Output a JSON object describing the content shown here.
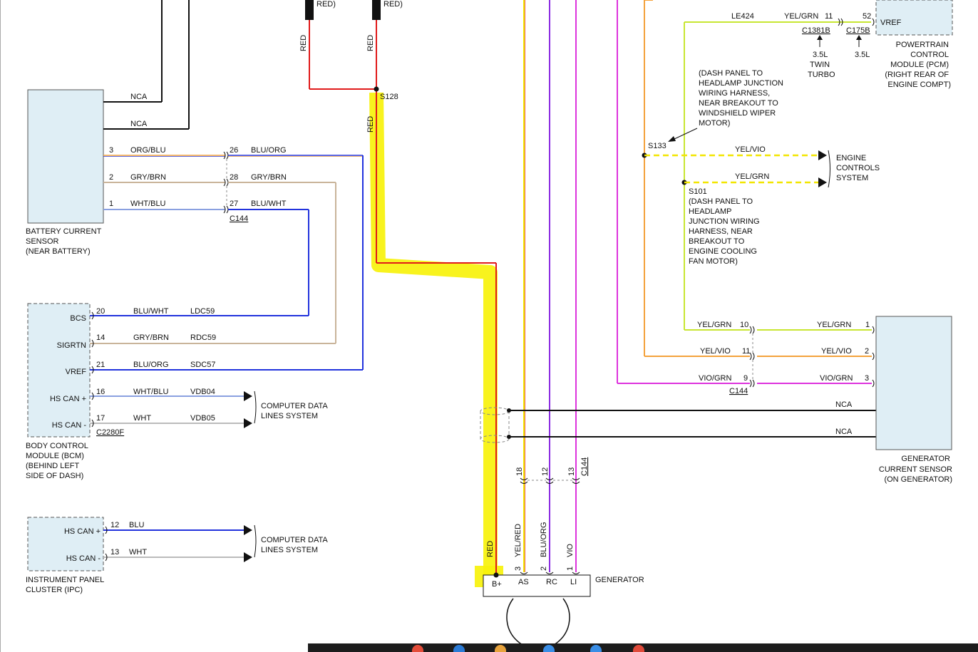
{
  "colors": {
    "red": "#e11a1a",
    "black": "#111111",
    "blue": "#2233dd",
    "orange": "#f4a23c",
    "tan": "#c9b49a",
    "grayblue": "#8aa0e0",
    "yellow": "#f2e600",
    "violet": "#8a2be2",
    "magenta": "#dd33dd",
    "yellowgreen": "#c8e632",
    "highlight": "#f7f20b",
    "module_fill": "#dfeef5",
    "module_border": "#555555"
  },
  "top": {
    "red_left": "RED)",
    "red_right": "RED)",
    "wire_red_1": "RED",
    "wire_red_2": "RED",
    "wire_red_3": "RED",
    "splice_s128": "S128"
  },
  "bcs_sensor": {
    "name_lines": [
      "BATTERY CURRENT",
      "SENSOR",
      "(NEAR BATTERY)"
    ],
    "nca_top": "NCA",
    "nca_bottom": "NCA",
    "pins": [
      {
        "pin": "3",
        "color": "ORG/BLU"
      },
      {
        "pin": "2",
        "color": "GRY/BRN"
      },
      {
        "pin": "1",
        "color": "WHT/BLU"
      }
    ]
  },
  "c144_left": {
    "pins": [
      {
        "pin": "26",
        "color": "BLU/ORG"
      },
      {
        "pin": "28",
        "color": "GRY/BRN"
      },
      {
        "pin": "27",
        "color": "BLU/WHT"
      }
    ],
    "label": "C144"
  },
  "bcm": {
    "name_lines": [
      "BODY CONTROL",
      "MODULE (BCM)",
      "(BEHIND LEFT",
      "SIDE OF DASH)"
    ],
    "pins": [
      {
        "name": "BCS",
        "pin": "20",
        "color": "BLU/WHT",
        "circuit": "LDC59"
      },
      {
        "name": "SIGRTN",
        "pin": "14",
        "color": "GRY/BRN",
        "circuit": "RDC59"
      },
      {
        "name": "VREF",
        "pin": "21",
        "color": "BLU/ORG",
        "circuit": "SDC57"
      },
      {
        "name": "HS CAN +",
        "pin": "16",
        "color": "WHT/BLU",
        "circuit": "VDB04"
      },
      {
        "name": "HS CAN -",
        "pin": "17",
        "color": "WHT",
        "circuit": "VDB05"
      }
    ],
    "connector": "C2280F",
    "cdl_lines": [
      "COMPUTER DATA",
      "LINES SYSTEM"
    ]
  },
  "ipc": {
    "name_lines": [
      "INSTRUMENT PANEL",
      "CLUSTER (IPC)"
    ],
    "pins": [
      {
        "name": "HS CAN +",
        "pin": "12",
        "color": "BLU"
      },
      {
        "name": "HS CAN -",
        "pin": "13",
        "color": "WHT"
      }
    ],
    "cdl_lines": [
      "COMPUTER DATA",
      "LINES SYSTEM"
    ]
  },
  "generator": {
    "name": "GENERATOR",
    "terminals": [
      {
        "name": "B+",
        "pin": "",
        "color": "RED"
      },
      {
        "name": "AS",
        "pin": "3",
        "color": "YEL/RED"
      },
      {
        "name": "RC",
        "pin": "2",
        "color": "BLU/ORG"
      },
      {
        "name": "LI",
        "pin": "1",
        "color": "VIO"
      }
    ],
    "c144_pins": [
      "18",
      "12",
      "13"
    ],
    "c144_label": "C144"
  },
  "pcm": {
    "circuit": "LE424",
    "color": "YEL/GRN",
    "c1381b_pin": "11",
    "c175b_pin": "52",
    "vref": "VREF",
    "c1381b": "C1381B",
    "c175b": "C175B",
    "note_left": [
      "3.5L",
      "TWIN",
      "TURBO"
    ],
    "note_right": "3.5L",
    "name_lines": [
      "POWERTRAIN",
      "CONTROL",
      "MODULE (PCM)",
      "(RIGHT REAR OF",
      "ENGINE COMPT)"
    ]
  },
  "s133": {
    "note_lines": [
      "(DASH PANEL TO",
      "HEADLAMP JUNCTION",
      "WIRING HARNESS,",
      "NEAR BREAKOUT TO",
      "WINDSHIELD WIPER",
      "MOTOR)"
    ],
    "label": "S133",
    "wire": "YEL/VIO"
  },
  "s101": {
    "label": "S101",
    "wire": "YEL/GRN",
    "note_lines": [
      "(DASH PANEL TO",
      "HEADLAMP",
      "JUNCTION WIRING",
      "HARNESS, NEAR",
      "BREAKOUT TO",
      "ENGINE COOLING",
      "FAN MOTOR)"
    ]
  },
  "ecs_lines": [
    "ENGINE",
    "CONTROLS",
    "SYSTEM"
  ],
  "gcs": {
    "rows": [
      {
        "left_color": "YEL/GRN",
        "c144_pin": "10",
        "right_color": "YEL/GRN",
        "pin": "1"
      },
      {
        "left_color": "YEL/VIO",
        "c144_pin": "11",
        "right_color": "YEL/VIO",
        "pin": "2"
      },
      {
        "left_color": "VIO/GRN",
        "c144_pin": "9",
        "right_color": "VIO/GRN",
        "pin": "3"
      }
    ],
    "c144": "C144",
    "nca_1": "NCA",
    "nca_2": "NCA",
    "name_lines": [
      "GENERATOR",
      "CURRENT SENSOR",
      "(ON GENERATOR)"
    ]
  }
}
